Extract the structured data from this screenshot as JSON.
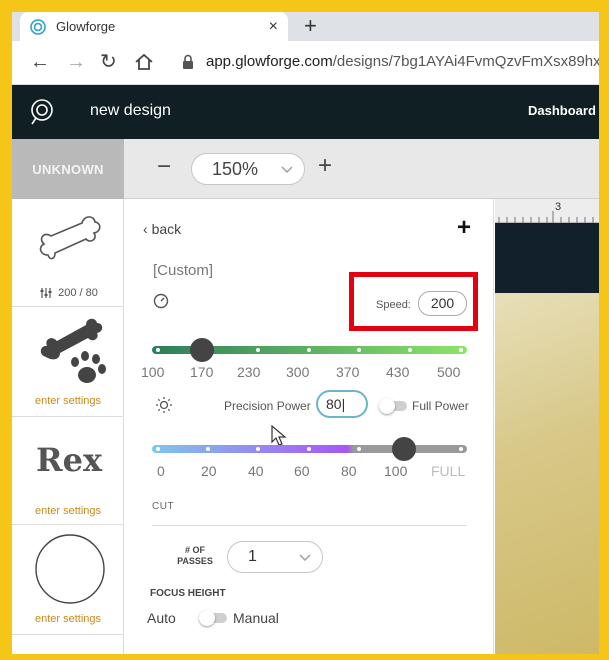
{
  "browser": {
    "tab_title": "Glowforge",
    "tab_close": "×",
    "new_tab": "+",
    "url_host": "app.glowforge.com",
    "url_path": "/designs/7bg1AYAi4FvmQzvFmXsx89hx"
  },
  "app": {
    "title": "new design",
    "dashboard": "Dashboard"
  },
  "toolbar": {
    "material": "UNKNOWN",
    "zoom_out": "−",
    "zoom_value": "150%",
    "zoom_in": "+"
  },
  "thumbnails": [
    {
      "icon": "bone-outline",
      "label": "200 / 80",
      "label_style": "plain"
    },
    {
      "icon": "bone-paw",
      "label": "enter settings"
    },
    {
      "icon": "rex-text",
      "text": "Rex",
      "label": "enter settings"
    },
    {
      "icon": "circle-outline",
      "label": "enter settings"
    }
  ],
  "settings": {
    "back": "back",
    "add": "+",
    "preset": "[Custom]",
    "speed_label": "Speed:",
    "speed_value": "200",
    "speed_ticks": [
      "100",
      "170",
      "230",
      "300",
      "370",
      "430",
      "500"
    ],
    "speed_level": 0.16,
    "precision_power_label": "Precision Power",
    "power_value": "80",
    "full_power_label": "Full Power",
    "power_ticks": [
      "0",
      "20",
      "40",
      "60",
      "80",
      "100",
      "FULL"
    ],
    "power_level": 0.8,
    "section": "CUT",
    "passes_label_1": "# OF",
    "passes_label_2": "PASSES",
    "passes_value": "1",
    "focus_height_label": "FOCUS HEIGHT",
    "focus_auto": "Auto",
    "focus_manual": "Manual"
  },
  "canvas": {
    "ruler_number": "3"
  },
  "colors": {
    "frame": "#f5c518",
    "app_header": "#0f1f23",
    "highlight": "#e3000f",
    "speed_track_start": "#2e7d5b",
    "speed_track_end": "#8ee36a",
    "power_track_start": "#7fc7e8",
    "power_track_mid": "#a855f7",
    "setting_label": "#c98a1c"
  }
}
